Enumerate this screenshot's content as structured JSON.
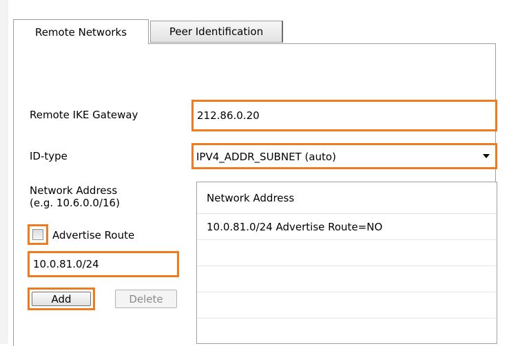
{
  "tabs": [
    {
      "label": "Remote Networks",
      "active": true
    },
    {
      "label": "Peer Identification",
      "active": false
    }
  ],
  "gateway": {
    "label": "Remote IKE Gateway",
    "value": "212.86.0.20"
  },
  "id_type": {
    "label": "ID-type",
    "selected": "IPV4_ADDR_SUBNET (auto)"
  },
  "network": {
    "label_line1": "Network Address",
    "label_line2": "(e.g. 10.6.0.0/16)",
    "advertise_label": "Advertise Route",
    "advertise_checked": false,
    "input_value": "10.0.81.0/24",
    "add_label": "Add",
    "delete_label": "Delete"
  },
  "list": {
    "header": "Network Address",
    "rows": [
      "10.0.81.0/24 Advertise Route=NO",
      "",
      "",
      "",
      ""
    ]
  },
  "colors": {
    "highlight": "#f07a1e",
    "border": "#9c9c9c"
  }
}
